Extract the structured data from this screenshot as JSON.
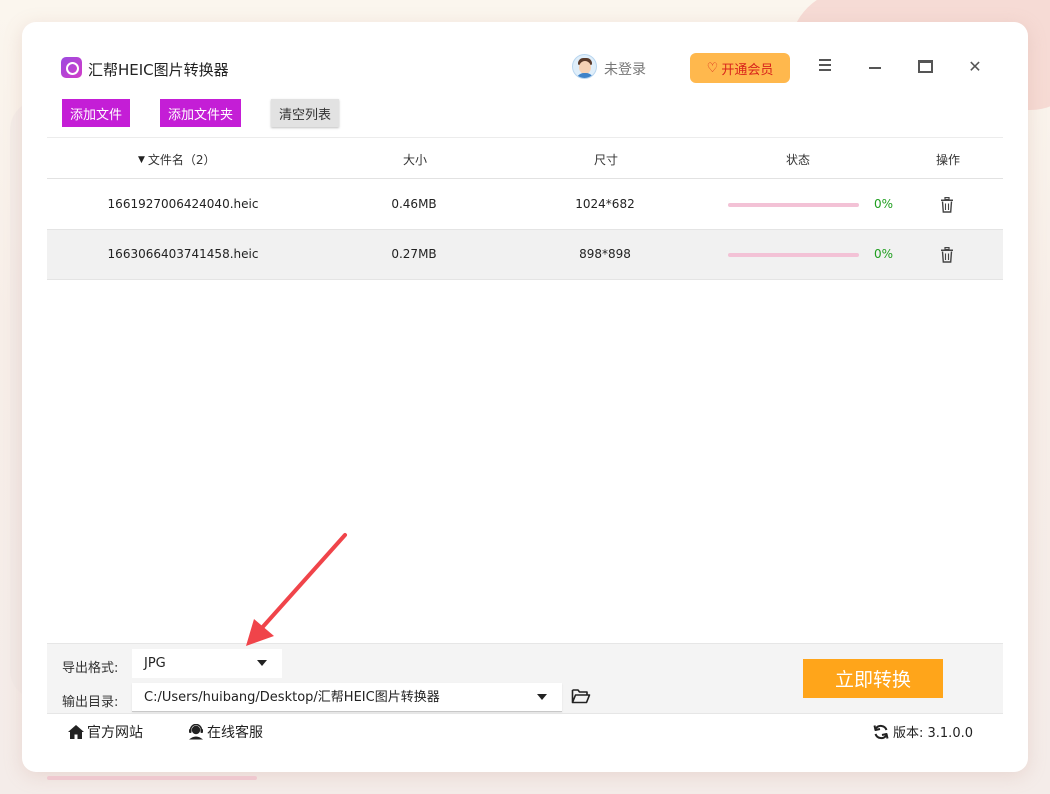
{
  "app": {
    "title": "汇帮HEIC图片转换器",
    "login_text": "未登录",
    "vip_label": "开通会员"
  },
  "toolbar": {
    "add_file": "添加文件",
    "add_folder": "添加文件夹",
    "clear_list": "清空列表"
  },
  "table": {
    "headers": {
      "name": "文件名（2）",
      "size": "大小",
      "dimensions": "尺寸",
      "status": "状态",
      "action": "操作"
    },
    "rows": [
      {
        "name": "1661927006424040.heic",
        "size": "0.46MB",
        "dimensions": "1024*682",
        "progress": 0,
        "percent": "0%"
      },
      {
        "name": "1663066403741458.heic",
        "size": "0.27MB",
        "dimensions": "898*898",
        "progress": 0,
        "percent": "0%"
      }
    ]
  },
  "settings": {
    "format_label": "导出格式:",
    "format_value": "JPG",
    "outdir_label": "输出目录:",
    "outdir_value": "C:/Users/huibang/Desktop/汇帮HEIC图片转换器",
    "convert_label": "立即转换"
  },
  "footer": {
    "site": "官方网站",
    "service": "在线客服",
    "version": "版本: 3.1.0.0"
  },
  "colors": {
    "accent_purple": "#c41ed6",
    "convert_orange": "#ffa51a",
    "vip_orange": "#ffb84d",
    "progress_green": "#1f9e1f",
    "annotation_red": "#f0444a"
  }
}
